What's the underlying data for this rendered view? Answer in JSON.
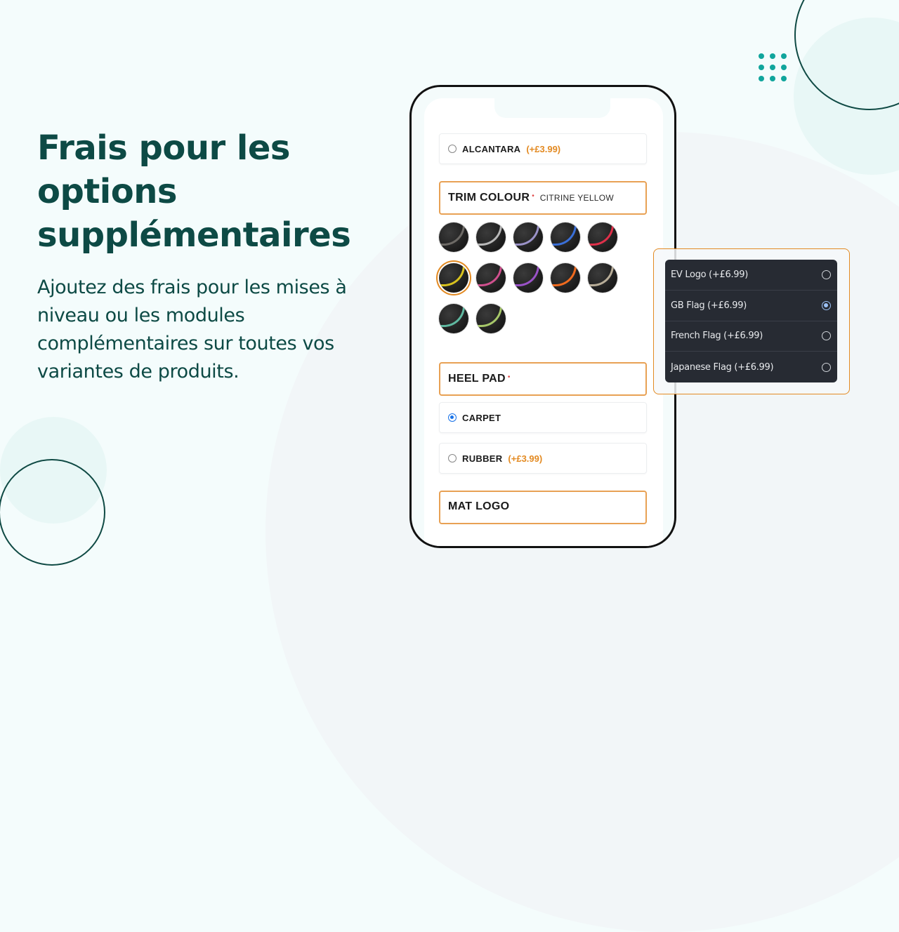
{
  "hero": {
    "headline": "Frais pour les options supplémentaires",
    "subtitle": "Ajoutez des frais pour les mises à niveau ou les modules complémentaires sur toutes vos variantes de produits."
  },
  "colors": {
    "brand_dark": "#0d4a45",
    "accent_teal": "#10a59c",
    "price_orange": "#e38a22",
    "section_border": "#e8a154",
    "radio_blue": "#1a73e8",
    "popup_bg": "#272b33"
  },
  "phone": {
    "options_top": [
      {
        "label": "ALCANTARA",
        "price": "(+£3.99)",
        "selected": false
      }
    ],
    "trim_colour": {
      "title": "TRIM COLOUR",
      "required_mark": "•",
      "value": "CITRINE YELLOW",
      "swatches": [
        {
          "name": "charcoal",
          "stitch": "#6d6a66",
          "selected": false
        },
        {
          "name": "silver",
          "stitch": "#b8b8b8",
          "selected": false
        },
        {
          "name": "lilac",
          "stitch": "#9a92c8",
          "selected": false
        },
        {
          "name": "blue",
          "stitch": "#3a6fd8",
          "selected": false
        },
        {
          "name": "red",
          "stitch": "#e0304a",
          "selected": false
        },
        {
          "name": "citrine-yellow",
          "stitch": "#d8c21e",
          "selected": true
        },
        {
          "name": "pink",
          "stitch": "#d0508e",
          "selected": false
        },
        {
          "name": "purple",
          "stitch": "#9a52c8",
          "selected": false
        },
        {
          "name": "orange",
          "stitch": "#f06a1e",
          "selected": false
        },
        {
          "name": "beige",
          "stitch": "#b8ad98",
          "selected": false
        },
        {
          "name": "teal",
          "stitch": "#5fb8a0",
          "selected": false
        },
        {
          "name": "lime",
          "stitch": "#a7c86a",
          "selected": false
        }
      ]
    },
    "heel_pad": {
      "title": "HEEL PAD",
      "required_mark": "•",
      "options": [
        {
          "label": "CARPET",
          "price": "",
          "selected": true
        },
        {
          "label": "RUBBER",
          "price": "(+£3.99)",
          "selected": false
        }
      ]
    },
    "mat_logo": {
      "title": "MAT LOGO"
    }
  },
  "popup": {
    "items": [
      {
        "label": "EV Logo (+£6.99)",
        "selected": false
      },
      {
        "label": "GB Flag (+£6.99)",
        "selected": true
      },
      {
        "label": "French Flag (+£6.99)",
        "selected": false
      },
      {
        "label": "Japanese Flag (+£6.99)",
        "selected": false
      }
    ]
  }
}
